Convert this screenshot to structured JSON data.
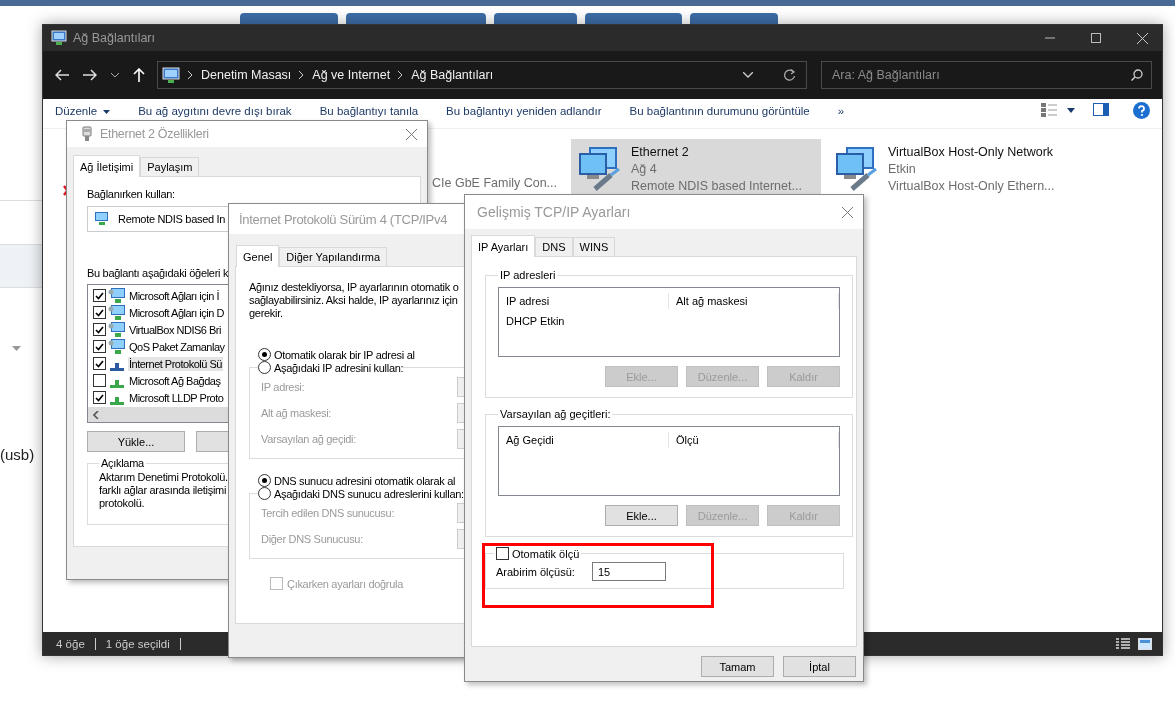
{
  "background_page": {
    "label": "(usb)"
  },
  "explorer": {
    "title": "Ağ Bağlantıları",
    "breadcrumb": [
      "Denetim Masası",
      "Ağ ve Internet",
      "Ağ Bağlantıları"
    ],
    "search": {
      "placeholder": "Ara: Ağ Bağlantıları"
    },
    "toolbar": [
      {
        "label": "Düzenle",
        "kind": "menu"
      },
      {
        "label": "Bu ağ aygıtını devre dışı bırak",
        "kind": "command"
      },
      {
        "label": "Bu bağlantıyı tanıla",
        "kind": "command"
      },
      {
        "label": "Bu bağlantıyı yeniden adlandır",
        "kind": "command"
      },
      {
        "label": "Bu bağlantının durumunu görüntüle",
        "kind": "command"
      },
      {
        "label": "»",
        "kind": "command"
      }
    ],
    "covered_connection": {
      "device": "CIe GbE Family Con..."
    },
    "connections": [
      {
        "name": "Ethernet 2",
        "status": "Ağ 4",
        "device": "Remote NDIS based Internet...",
        "selected": true
      },
      {
        "name": "VirtualBox Host-Only Network",
        "status": "Etkin",
        "device": "VirtualBox Host-Only Ethern...",
        "selected": false
      }
    ],
    "status_bar": [
      "4 öğe",
      "1 öğe seçildi"
    ]
  },
  "properties_dialog": {
    "title": "Ethernet 2 Özellikleri",
    "tabs": [
      {
        "label": "Ağ İletişimi",
        "selected": true
      },
      {
        "label": "Paylaşım",
        "selected": false
      }
    ],
    "connect_using_label": "Bağlanırken kullan:",
    "adapter": "Remote NDIS based In",
    "items_label": "Bu bağlantı aşağıdaki öğeleri k",
    "components": [
      {
        "name": "Microsoft Ağları için İ",
        "checked": true,
        "kind": "service",
        "selected": false
      },
      {
        "name": "Microsoft Ağları için D",
        "checked": true,
        "kind": "service",
        "selected": false
      },
      {
        "name": "VirtualBox NDIS6 Bri",
        "checked": true,
        "kind": "service",
        "selected": false
      },
      {
        "name": "QoS Paket Zamanlay",
        "checked": true,
        "kind": "service",
        "selected": false
      },
      {
        "name": "İnternet Protokolü Sü",
        "checked": true,
        "kind": "protocol",
        "selected": true
      },
      {
        "name": "Microsoft Ağ Bağdaş",
        "checked": false,
        "kind": "protocol",
        "selected": false
      },
      {
        "name": "Microsoft LLDP Proto",
        "checked": true,
        "kind": "protocol",
        "selected": false
      }
    ],
    "install_button": "Yükle...",
    "description": {
      "title": "Açıklama",
      "lines": [
        "Aktarım Denetimi Protokolü.",
        "farklı ağlar arasında iletişimi",
        "protokolü."
      ]
    }
  },
  "ipv4_dialog": {
    "title": "İnternet Protokolü Sürüm 4 (TCP/IPv4",
    "tabs": [
      {
        "label": "Genel",
        "selected": true
      },
      {
        "label": "Diğer Yapılandırma",
        "selected": false
      }
    ],
    "intro_lines": [
      "Ağınız destekliyorsa, IP ayarlarının otomatik o",
      "sağlayabilirsiniz. Aksi halde, IP ayarlarınız için",
      "gerekir."
    ],
    "ip_options": [
      {
        "label": "Otomatik olarak bir IP adresi al",
        "selected": true
      },
      {
        "label": "Aşağıdaki IP adresini kullan:",
        "selected": false
      }
    ],
    "ip_fields": [
      {
        "label": "IP adresi:",
        "disabled": true
      },
      {
        "label": "Alt ağ maskesi:",
        "disabled": true
      },
      {
        "label": "Varsayılan ağ geçidi:",
        "disabled": true
      }
    ],
    "dns_options": [
      {
        "label": "DNS sunucu adresini otomatik olarak al",
        "selected": true
      },
      {
        "label": "Aşağıdaki DNS sunucu adreslerini kullan:",
        "selected": false
      }
    ],
    "dns_fields": [
      {
        "label": "Tercih edilen DNS sunucusu:",
        "disabled": true
      },
      {
        "label": "Diğer DNS Sunucusu:",
        "disabled": true
      }
    ],
    "validate": {
      "label": "Çıkarken ayarları doğrula",
      "checked": false,
      "disabled": true
    }
  },
  "advanced_dialog": {
    "title": "Gelişmiş TCP/IP Ayarları",
    "tabs": [
      {
        "label": "IP Ayarları",
        "selected": true
      },
      {
        "label": "DNS",
        "selected": false
      },
      {
        "label": "WINS",
        "selected": false
      }
    ],
    "groups": [
      {
        "title": "IP adresleri",
        "columns": [
          "IP adresi",
          "Alt ağ maskesi"
        ],
        "rows": [
          "DHCP Etkin"
        ],
        "buttons": [
          {
            "label": "Ekle...",
            "disabled": true
          },
          {
            "label": "Düzenle...",
            "disabled": true
          },
          {
            "label": "Kaldır",
            "disabled": true
          }
        ]
      },
      {
        "title": "Varsayılan ağ geçitleri:",
        "columns": [
          "Ağ Geçidi",
          "Ölçü"
        ],
        "buttons": [
          {
            "label": "Ekle...",
            "disabled": false
          },
          {
            "label": "Düzenle...",
            "disabled": true
          },
          {
            "label": "Kaldır",
            "disabled": true
          }
        ]
      }
    ],
    "metric": {
      "auto_label": "Otomatik ölçü",
      "auto_checked": false,
      "label": "Arabirim ölçüsü:",
      "value": "15",
      "highlighted": true
    },
    "buttons": [
      "Tamam",
      "İptal"
    ]
  }
}
